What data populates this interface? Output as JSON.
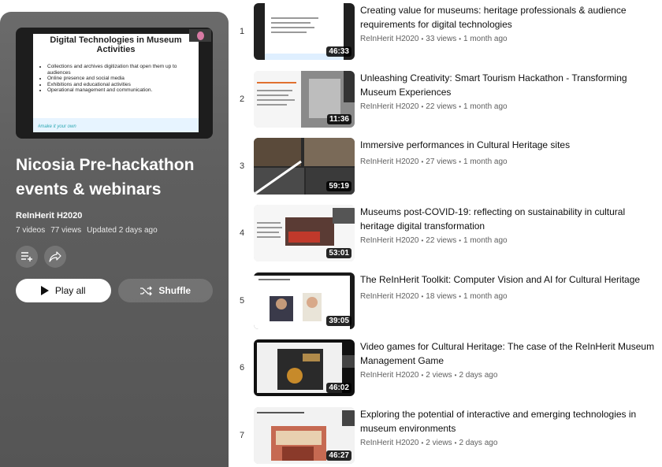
{
  "playlist": {
    "cover": {
      "slide_title": "Digital Technologies in Museum Activities",
      "bullets": [
        "Collections and archives digitization that open them up to audiences",
        "Online presence and social media",
        "Exhibitions and educational activities",
        "Operational management and communication."
      ],
      "footer_tag": "#make it your own"
    },
    "title": "Nicosia Pre-hackathon events & webinars",
    "owner": "ReInHerit H2020",
    "video_count": "7 videos",
    "views": "77 views",
    "updated": "Updated 2 days ago",
    "play_all_label": "Play all",
    "shuffle_label": "Shuffle"
  },
  "videos": [
    {
      "index": "1",
      "title_line1": "Creating value for museums: heritage professionals & audience",
      "title_line2": "requirements for digital technologies",
      "channel": "ReInHerit H2020",
      "views": "33 views",
      "age": "1 month ago",
      "duration": "46:33"
    },
    {
      "index": "2",
      "title_line1": "Unleashing Creativity: Smart Tourism Hackathon - Transforming",
      "title_line2": "Museum Experiences",
      "channel": "ReInHerit H2020",
      "views": "22 views",
      "age": "1 month ago",
      "duration": "11:36"
    },
    {
      "index": "3",
      "title_line1": "Immersive performances in Cultural Heritage sites",
      "title_line2": "",
      "channel": "ReInHerit H2020",
      "views": "27 views",
      "age": "1 month ago",
      "duration": "59:19"
    },
    {
      "index": "4",
      "title_line1": "Museums post-COVID-19: reflecting on sustainability in cultural",
      "title_line2": "heritage digital transformation",
      "channel": "ReInHerit H2020",
      "views": "22 views",
      "age": "1 month ago",
      "duration": "53:01"
    },
    {
      "index": "5",
      "title_line1": "The ReInHerit Toolkit: Computer Vision and AI for Cultural Heritage",
      "title_line2": "",
      "channel": "ReInHerit H2020",
      "views": "18 views",
      "age": "1 month ago",
      "duration": "39:05"
    },
    {
      "index": "6",
      "title_line1": "Video games for Cultural Heritage: The case of the ReInHerit Museum",
      "title_line2": "Management Game",
      "channel": "ReInHerit H2020",
      "views": "2 views",
      "age": "2 days ago",
      "duration": "46:02"
    },
    {
      "index": "7",
      "title_line1": "Exploring the potential of interactive and emerging technologies in",
      "title_line2": "museum environments",
      "channel": "ReInHerit H2020",
      "views": "2 views",
      "age": "2 days ago",
      "duration": "46:27"
    }
  ],
  "colors": {
    "panel_bg": "#5f5f5f",
    "text_primary": "#0f0f0f",
    "text_secondary": "#606060"
  }
}
